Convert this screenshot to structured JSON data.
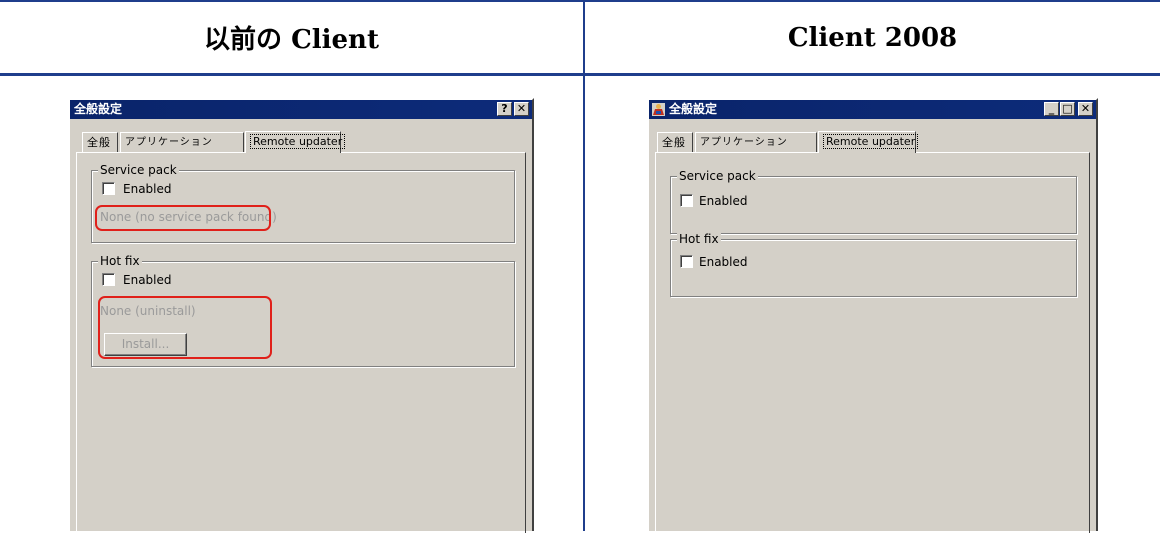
{
  "header": {
    "left_title": "以前の Client",
    "right_title": "Client 2008"
  },
  "dialog_left": {
    "title": "全般設定",
    "help_button": "?",
    "close_button": "✕",
    "tabs": [
      {
        "label": "全般"
      },
      {
        "label": "アプリケーション"
      },
      {
        "label": "Remote updater"
      }
    ],
    "service_pack": {
      "legend": "Service pack",
      "checkbox_label": "Enabled",
      "status": "None (no service pack found)"
    },
    "hot_fix": {
      "legend": "Hot fix",
      "checkbox_label": "Enabled",
      "status": "None (uninstall)",
      "install_button": "Install..."
    }
  },
  "dialog_right": {
    "title": "全般設定",
    "minimize_button": "_",
    "maximize_button": "□",
    "close_button": "✕",
    "tabs": [
      {
        "label": "全般"
      },
      {
        "label": "アプリケーション"
      },
      {
        "label": "Remote updater"
      }
    ],
    "service_pack": {
      "legend": "Service pack",
      "checkbox_label": "Enabled"
    },
    "hot_fix": {
      "legend": "Hot fix",
      "checkbox_label": "Enabled"
    }
  },
  "colors": {
    "frame_rule": "#1f3e8c",
    "titlebar": "#0a246a",
    "dialog_face": "#d4d0c8",
    "highlight_marker": "#e0201a"
  }
}
